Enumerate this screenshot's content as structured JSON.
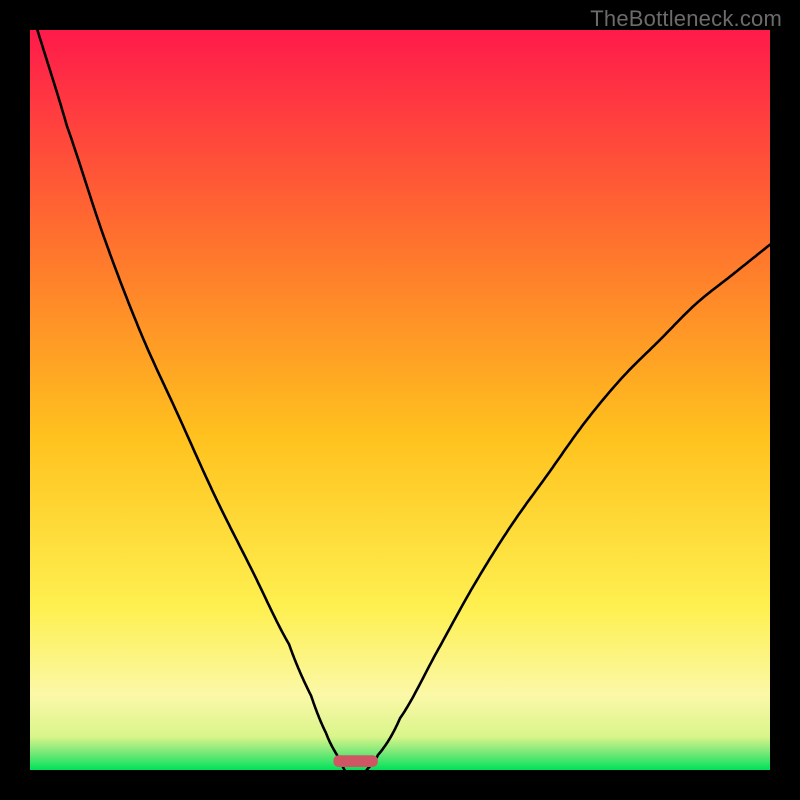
{
  "watermark": "TheBottleneck.com",
  "chart_data": {
    "type": "line",
    "title": "",
    "xlabel": "",
    "ylabel": "",
    "xlim": [
      0,
      100
    ],
    "ylim": [
      0,
      100
    ],
    "legend": false,
    "gradient_colors": {
      "top": "#ff1a4b",
      "upper_mid": "#ff8a2a",
      "mid": "#ffd31a",
      "lower_mid": "#fcf46f",
      "green": "#00e25a"
    },
    "series": [
      {
        "name": "left-curve",
        "description": "Steep decreasing curve from top-left to a minimum near x≈42",
        "x": [
          1,
          5,
          10,
          15,
          20,
          25,
          30,
          35,
          38,
          40,
          41.5,
          42.5
        ],
        "y": [
          100,
          87,
          72,
          59,
          48,
          37,
          27,
          17,
          10,
          5,
          2,
          0
        ]
      },
      {
        "name": "right-curve",
        "description": "Increasing curve from the minimum near x≈45 toward upper-right",
        "x": [
          45.5,
          47,
          50,
          55,
          60,
          65,
          70,
          75,
          80,
          85,
          90,
          95,
          100
        ],
        "y": [
          0,
          2,
          7,
          16,
          25,
          33,
          40,
          47,
          53,
          58,
          63,
          67,
          71
        ]
      }
    ],
    "marker": {
      "description": "Small rounded bar at the curve minimum on the x-axis",
      "x_center": 44,
      "width": 6,
      "color": "#cf5763"
    }
  }
}
